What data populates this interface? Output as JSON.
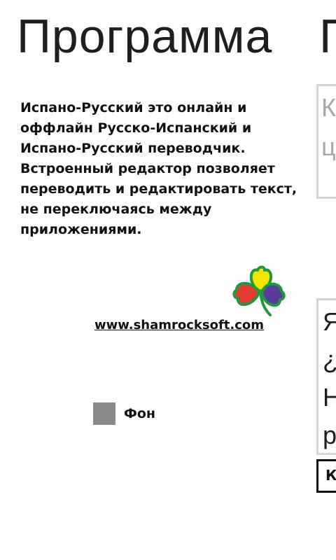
{
  "page": {
    "title": "Программа",
    "next_title_fragment": "П"
  },
  "about": {
    "description": "Испано-Русский это онлайн и оффлайн Русско-Испанский и Испано-Русский переводчик. Встроенный редактор позволяет переводить и редактировать текст, не переключаясь между приложениями.",
    "website": "www.shamrocksoft.com",
    "logo_icon": "shamrock-logo-icon",
    "background_option": {
      "label": "Фон",
      "swatch_color": "#8a8a8a"
    }
  },
  "next_panel": {
    "input_lines": [
      "К",
      "ц"
    ],
    "output_lines": [
      "Я",
      "¿",
      "Н",
      "р"
    ],
    "button_label": "К"
  },
  "colors": {
    "logo_leaf_yellow": "#f2e600",
    "logo_leaf_red": "#e23a2e",
    "logo_leaf_blue": "#5b3a9e",
    "logo_outline_green": "#1e9a3a"
  }
}
